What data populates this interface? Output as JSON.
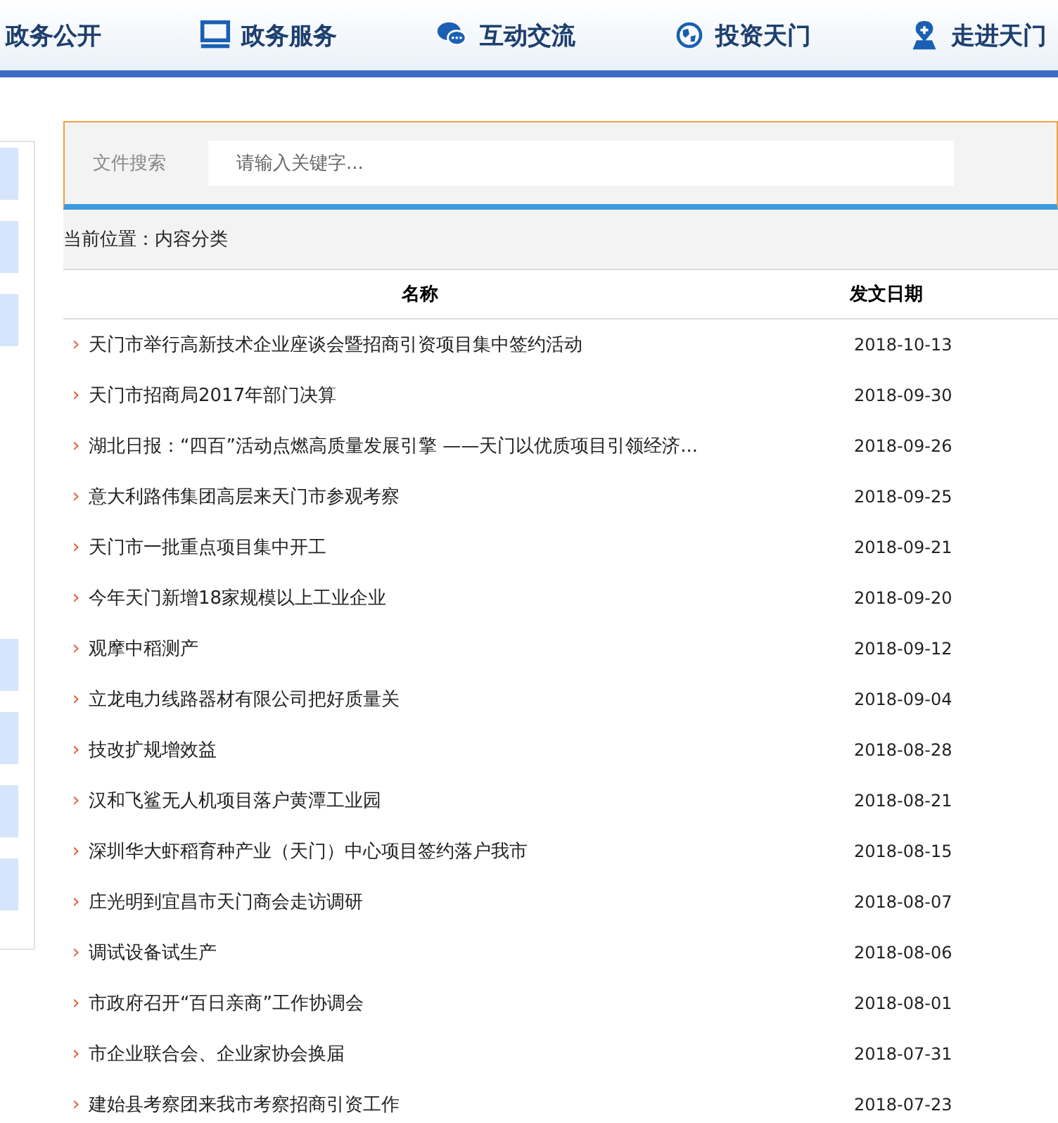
{
  "nav": [
    {
      "label": "政务公开"
    },
    {
      "label": "政务服务"
    },
    {
      "label": "互动交流"
    },
    {
      "label": "投资天门"
    },
    {
      "label": "走进天门"
    }
  ],
  "search": {
    "label": "文件搜索",
    "placeholder": "请输入关键字..."
  },
  "breadcrumb": "当前位置：内容分类",
  "table": {
    "columns": [
      "名称",
      "发文日期"
    ],
    "rows": [
      {
        "marker": "›",
        "title": "天门市举行高新技术企业座谈会暨招商引资项目集中签约活动",
        "date": "2018-10-13"
      },
      {
        "marker": "›",
        "title": "天门市招商局2017年部门决算",
        "date": "2018-09-30"
      },
      {
        "marker": "›",
        "title": "湖北日报：“四百”活动点燃高质量发展引擎 ——天门以优质项目引领经济...",
        "date": "2018-09-26"
      },
      {
        "marker": "›",
        "title": "意大利路伟集团高层来天门市参观考察",
        "date": "2018-09-25"
      },
      {
        "marker": "›",
        "title": "天门市一批重点项目集中开工",
        "date": "2018-09-21"
      },
      {
        "marker": "›",
        "title": "今年天门新增18家规模以上工业企业",
        "date": "2018-09-20"
      },
      {
        "marker": "›",
        "title": "观摩中稻测产",
        "date": "2018-09-12"
      },
      {
        "marker": "›",
        "title": "立龙电力线路器材有限公司把好质量关",
        "date": "2018-09-04"
      },
      {
        "marker": "›",
        "title": "技改扩规增效益",
        "date": "2018-08-28"
      },
      {
        "marker": "›",
        "title": "汉和飞鲨无人机项目落户黄潭工业园",
        "date": "2018-08-21"
      },
      {
        "marker": "›",
        "title": "深圳华大虾稻育种产业（天门）中心项目签约落户我市",
        "date": "2018-08-15"
      },
      {
        "marker": "›",
        "title": "庄光明到宜昌市天门商会走访调研",
        "date": "2018-08-07"
      },
      {
        "marker": "›",
        "title": "调试设备试生产",
        "date": "2018-08-06"
      },
      {
        "marker": "›",
        "title": "市政府召开“百日亲商”工作协调会",
        "date": "2018-08-01"
      },
      {
        "marker": "›",
        "title": "市企业联合会、企业家协会换届",
        "date": "2018-07-31"
      },
      {
        "marker": "›",
        "title": "建始县考察团来我市考察招商引资工作",
        "date": "2018-07-23"
      }
    ]
  }
}
